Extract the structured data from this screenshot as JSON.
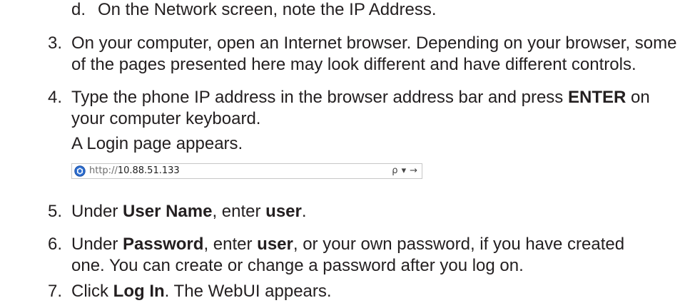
{
  "steps": {
    "d": {
      "marker": "d.",
      "text": "On the Network screen, note the IP Address."
    },
    "s3": {
      "marker": "3.",
      "line1": "On your computer, open an Internet browser. Depending on your browser, some",
      "line2": "of the pages presented here may look different and have different controls."
    },
    "s4": {
      "marker": "4.",
      "line1_a": "Type the phone IP address in the browser address bar and press ",
      "line1_b": "ENTER",
      "line1_c": " on",
      "line2": "your computer keyboard.",
      "line3": "A Login page appears."
    },
    "address_bar": {
      "protocol": "http://",
      "host": "10.88.51.133",
      "search_icon": "search-icon",
      "dropdown_icon": "chevron-down-icon",
      "go_icon": "arrow-right-icon",
      "search_glyph": "ρ",
      "dropdown_glyph": "▾",
      "go_glyph": "→"
    },
    "s5": {
      "marker": "5.",
      "a": "Under ",
      "b": "User Name",
      "c": ", enter ",
      "d": "user",
      "e": "."
    },
    "s6": {
      "marker": "6.",
      "a": "Under ",
      "b": "Password",
      "c": ", enter ",
      "d": "user",
      "e": ", or your own password, if you have created",
      "line2": "one. You can create or change a password after you log on."
    },
    "s7": {
      "marker": "7.",
      "a": "Click ",
      "b": "Log In",
      "c": ". The WebUI appears."
    }
  }
}
